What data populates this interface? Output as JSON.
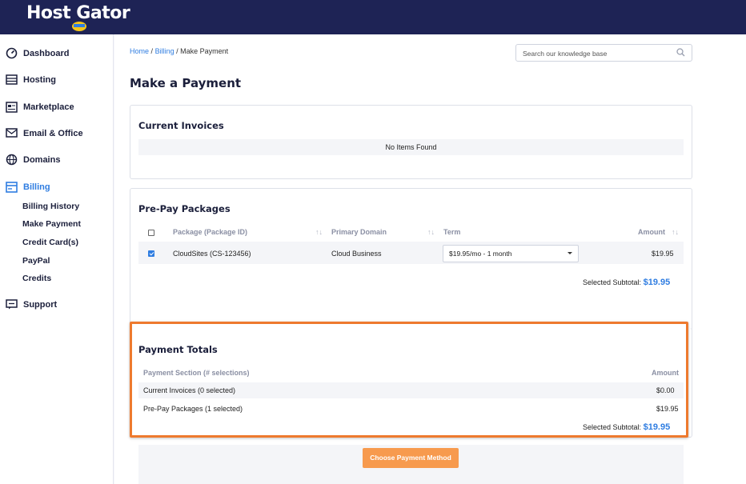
{
  "header": {
    "logo_text": "Host Gator"
  },
  "sidebar": {
    "items": [
      {
        "label": "Dashboard",
        "icon": "dashboard-icon"
      },
      {
        "label": "Hosting",
        "icon": "hosting-icon"
      },
      {
        "label": "Marketplace",
        "icon": "marketplace-icon"
      },
      {
        "label": "Email & Office",
        "icon": "email-icon"
      },
      {
        "label": "Domains",
        "icon": "globe-icon"
      },
      {
        "label": "Billing",
        "icon": "billing-icon",
        "active": true
      },
      {
        "label": "Support",
        "icon": "support-icon"
      }
    ],
    "billing_sub": [
      "Billing History",
      "Make Payment",
      "Credit Card(s)",
      "PayPal",
      "Credits"
    ]
  },
  "breadcrumb": {
    "home": "Home",
    "billing": "Billing",
    "current": "Make Payment",
    "sep": "/"
  },
  "search": {
    "placeholder": "Search our knowledge base"
  },
  "page_title": "Make a Payment",
  "current_invoices": {
    "title": "Current Invoices",
    "empty_text": "No Items Found"
  },
  "prepay": {
    "title": "Pre-Pay Packages",
    "columns": [
      "Package (Package ID)",
      "Primary Domain",
      "Term",
      "Amount"
    ],
    "rows": [
      {
        "package": "CloudSites (CS-123456)",
        "domain": "Cloud Business",
        "term": "$19.95/mo - 1 month",
        "amount": "$19.95",
        "checked": true
      }
    ],
    "subtotal_label": "Selected Subtotal:",
    "subtotal_value": "$19.95"
  },
  "payment_totals": {
    "title": "Payment Totals",
    "col_section": "Payment Section (# selections)",
    "col_amount": "Amount",
    "rows": [
      {
        "label": "Current Invoices (0 selected)",
        "amount": "$0.00"
      },
      {
        "label": "Pre-Pay Packages (1 selected)",
        "amount": "$19.95"
      }
    ],
    "subtotal_label": "Selected Subtotal:",
    "subtotal_value": "$19.95"
  },
  "actions": {
    "choose_payment": "Choose Payment Method"
  },
  "colors": {
    "nav_bg": "#1e2355",
    "accent": "#2f7de1",
    "highlight": "#ee7a2e",
    "button": "#f79a4e"
  }
}
